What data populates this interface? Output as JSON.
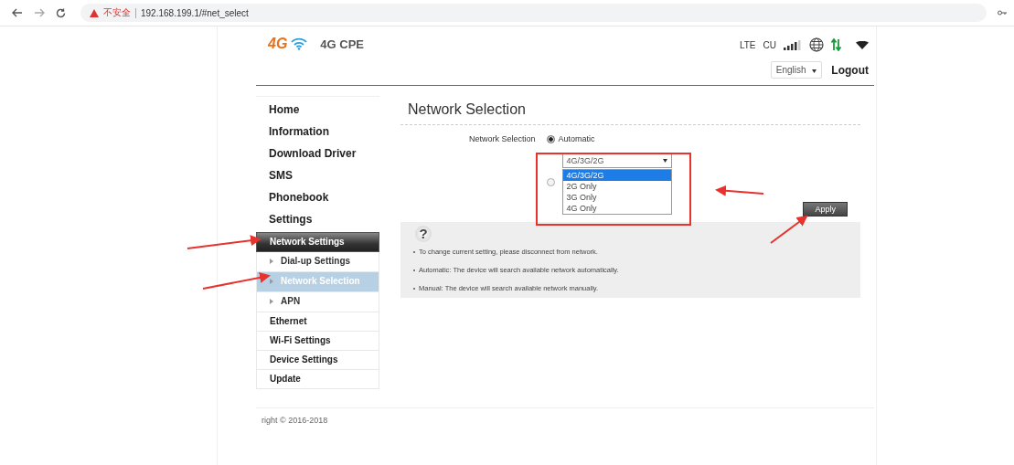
{
  "browser": {
    "security_warning": "不安全",
    "url": "192.168.199.1/#net_select"
  },
  "header": {
    "logo": "4G",
    "product": "4G CPE",
    "network_type": "LTE",
    "carrier": "CU",
    "language": "English",
    "logout": "Logout"
  },
  "sidebar": {
    "items": [
      {
        "label": "Home",
        "kind": "main",
        "selected": false
      },
      {
        "label": "Information",
        "kind": "main",
        "selected": false
      },
      {
        "label": "Download Driver",
        "kind": "main",
        "selected": false
      },
      {
        "label": "SMS",
        "kind": "main",
        "selected": false
      },
      {
        "label": "Phonebook",
        "kind": "main",
        "selected": false
      },
      {
        "label": "Settings",
        "kind": "main",
        "selected": false
      },
      {
        "label": "Network Settings",
        "kind": "section",
        "selected": true,
        "children": [
          {
            "label": "Dial-up Settings",
            "selected": false
          },
          {
            "label": "Network Selection",
            "selected": true
          },
          {
            "label": "APN",
            "selected": false
          }
        ]
      },
      {
        "label": "Ethernet",
        "kind": "section",
        "selected": false
      },
      {
        "label": "Wi-Fi Settings",
        "kind": "section",
        "selected": false
      },
      {
        "label": "Device Settings",
        "kind": "section",
        "selected": false
      },
      {
        "label": "Update",
        "kind": "section",
        "selected": false
      }
    ]
  },
  "content": {
    "title": "Network Selection",
    "field_label": "Network Selection",
    "modes": [
      {
        "kind": "label",
        "label": "Automatic",
        "selected": true
      },
      {
        "kind": "dropdown",
        "selected": false
      }
    ],
    "dropdown": {
      "value": "4G/3G/2G",
      "expanded": true,
      "options": [
        {
          "label": "4G/3G/2G",
          "selected": true
        },
        {
          "label": "2G Only",
          "selected": false
        },
        {
          "label": "3G Only",
          "selected": false
        },
        {
          "label": "4G Only",
          "selected": false
        }
      ]
    },
    "apply": "Apply",
    "help": {
      "icon": "?",
      "notes": [
        "To change current setting, please disconnect from network.",
        "Automatic: The device will search available network automatically.",
        "Manual: The device will search available network manually."
      ]
    }
  },
  "footer": {
    "copyright": "right © 2016-2018"
  }
}
